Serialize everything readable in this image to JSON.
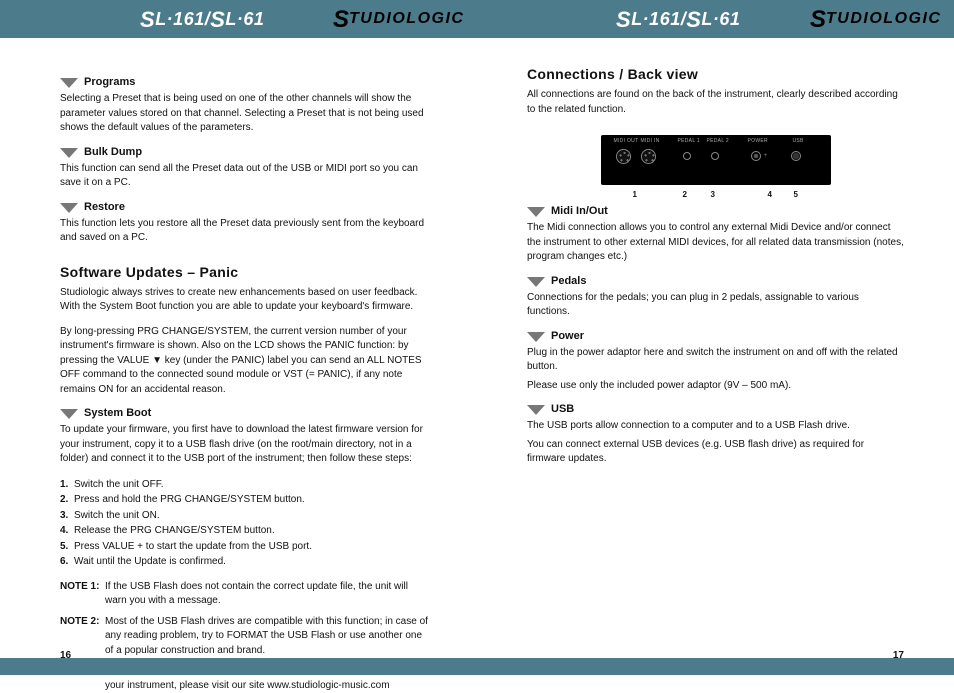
{
  "brand": {
    "model_prefix_big": "S",
    "model_rest_1": "L·161/",
    "model_rest_2": "L·61",
    "logo_big": "S",
    "logo_rest": "TUDIOLOGIC"
  },
  "left": {
    "pagenum": "16",
    "s1_title": "Programs",
    "s1_body": "Selecting a Preset that is being used on one of the other channels will show the parameter values stored on that channel. Selecting a Preset that is not being used shows the default values of the parameters.",
    "s2_title": "Bulk Dump",
    "s2_body": "This function can send all the Preset data out of the USB or MIDI port so you can save it on a PC.",
    "s3_title": "Restore",
    "s3_body": "This function lets you restore all the Preset data previously sent from the keyboard and saved on a PC.",
    "s1b_title": "Software Updates – Panic",
    "s1b_body_1": "Studiologic always strives to create new enhancements based on user feedback. With the System Boot function you are able to update your keyboard's firmware.",
    "s1b_body_2": "By long-pressing PRG CHANGE/SYSTEM, the current version number of your instrument's firmware is shown. Also on the LCD shows the PANIC function: by pressing the VALUE ▼ key (under the PANIC) label you can send an ALL NOTES OFF command to the connected sound module or VST (= PANIC), if any note remains ON for an accidental reason.",
    "s2b_title": "System Boot",
    "s2b_body": "To update your firmware, you first have to download the latest firmware version for your instrument, copy it to a USB flash drive (on the root/main directory, not in a folder) and connect it to the USB port of the instrument; then follow these steps:",
    "s2b_steps": [
      "Switch the unit OFF.",
      "Press and hold the PRG CHANGE/SYSTEM button.",
      "Switch the unit ON.",
      "Release the PRG CHANGE/SYSTEM button.",
      "Press VALUE + to start the update from the USB port.",
      "Wait until the Update is confirmed."
    ],
    "note1_lbl": "NOTE 1:",
    "note1_txt": "If the USB Flash does not contain the correct update file, the unit will warn you with a message.",
    "note2_lbl": "NOTE 2:",
    "note2_body_a": "Most of the USB Flash drives are compatible with this function; in case of any reading problem, try to FORMAT the USB Flash or use another one of a popular construction and brand.",
    "note2_body_b": "To download future firmware versions and get more information about your instrument, please visit our site www.studiologic-music.com"
  },
  "right": {
    "pagenum": "17",
    "h1": "Connections / Back view",
    "h1_body": "All connections are found on the back of the instrument, clearly described according to the related function.",
    "rear": {
      "labels": {
        "out": "MIDI OUT",
        "in": "MIDI IN",
        "p1": "PEDAL 1",
        "p2": "PEDAL 2",
        "pwr": "POWER",
        "usb": "USB"
      },
      "nums": {
        "n1": "1",
        "n2": "2",
        "n3": "3",
        "n4": "4",
        "n5": "5"
      }
    },
    "s_midi": "Midi In/Out",
    "s_midi_body": "The Midi connection allows you to control any external Midi Device and/or connect the instrument to other external MIDI devices, for all related data transmission (notes, program changes etc.)",
    "s_ped": "Pedals",
    "s_ped_body": "Connections for the pedals; you can plug in 2 pedals, assignable to various functions.",
    "s_pwr": "Power",
    "s_pwr_body_1": "Plug in the power adaptor here and switch the instrument on and off with the related button.",
    "s_pwr_body_2": "Please use only the included power adaptor (9V – 500 mA).",
    "s_usb": "USB",
    "s_usb_body_1": "The USB ports allow connection to a computer and to a USB Flash drive.",
    "s_usb_body_2": "You can connect external USB devices (e.g. USB flash drive) as required for firmware updates."
  }
}
